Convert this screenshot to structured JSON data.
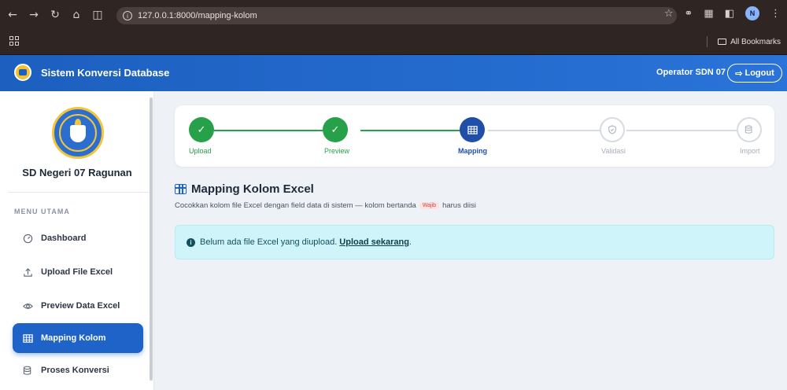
{
  "browser": {
    "url": "127.0.0.1:8000/mapping-kolom",
    "bookmarks_label": "All Bookmarks",
    "profile_initial": "N"
  },
  "header": {
    "app_title": "Sistem Konversi Database",
    "operator": "Operator SDN 07",
    "logout_label": "Logout"
  },
  "sidebar": {
    "school_name": "SD Negeri 07 Ragunan",
    "menu_heading": "MENU UTAMA",
    "items": [
      {
        "label": "Dashboard",
        "icon": "gauge-icon"
      },
      {
        "label": "Upload File Excel",
        "icon": "upload-icon"
      },
      {
        "label": "Preview Data Excel",
        "icon": "eye-icon"
      },
      {
        "label": "Mapping Kolom",
        "icon": "table-icon",
        "active": true
      },
      {
        "label": "Proses Konversi",
        "icon": "database-icon"
      }
    ]
  },
  "stepper": {
    "steps": [
      {
        "label": "Upload",
        "state": "done"
      },
      {
        "label": "Preview",
        "state": "done"
      },
      {
        "label": "Mapping",
        "state": "current"
      },
      {
        "label": "Validasi",
        "state": "pending"
      },
      {
        "label": "Import",
        "state": "pending"
      }
    ]
  },
  "main": {
    "title": "Mapping Kolom Excel",
    "subtitle_before": "Cocokkan kolom file Excel dengan field data di sistem — kolom bertanda",
    "badge": "Wajib",
    "subtitle_after": "harus diisi",
    "alert_text": "Belum ada file Excel yang diupload.",
    "alert_link": "Upload sekarang",
    "alert_end": "."
  },
  "colors": {
    "primary": "#1f63c9",
    "success": "#27a04a",
    "alert_bg": "#cff4fa"
  }
}
